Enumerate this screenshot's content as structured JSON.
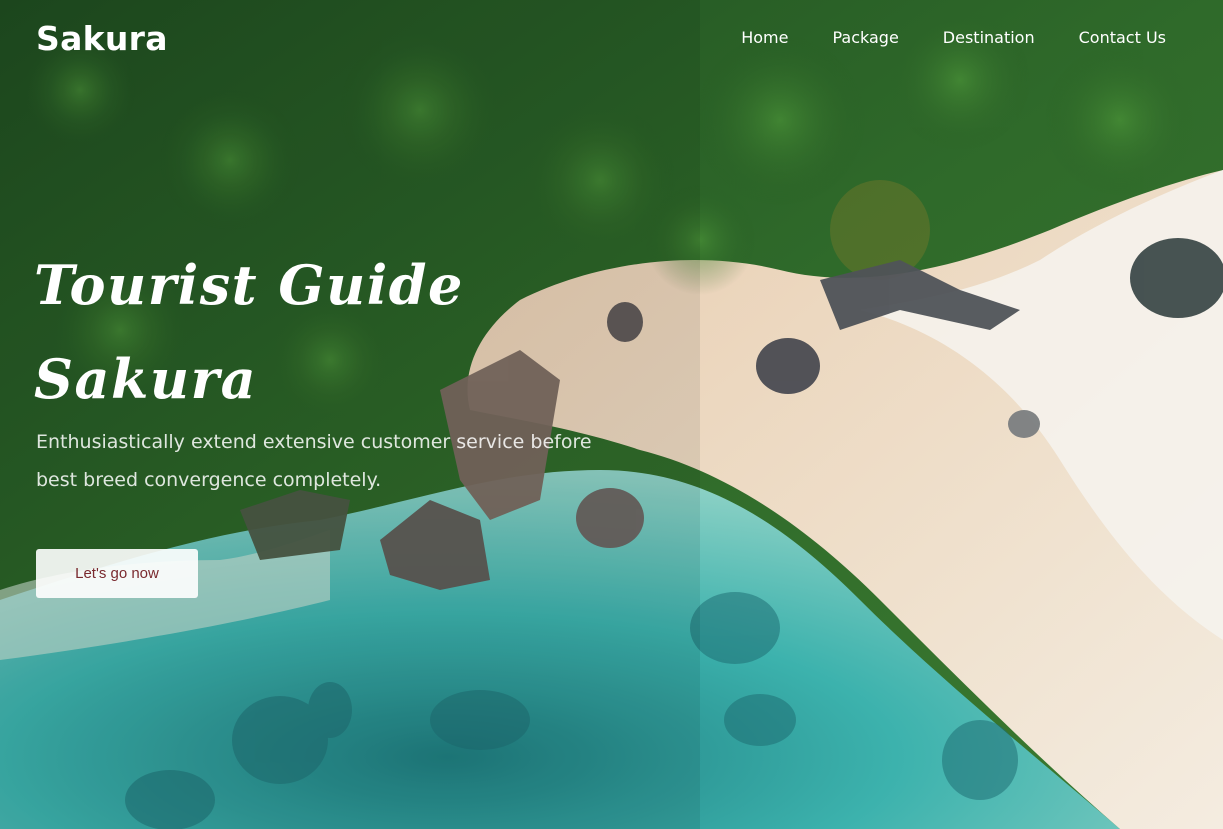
{
  "brand": {
    "name": "Sakura"
  },
  "nav": {
    "items": [
      {
        "label": "Home"
      },
      {
        "label": "Package"
      },
      {
        "label": "Destination"
      },
      {
        "label": "Contact Us"
      }
    ]
  },
  "hero": {
    "title_line1": "Tourist Guide",
    "title_line2": "Sakura",
    "description": "Enthusiastically extend extensive customer service before best breed convergence completely.",
    "cta_label": "Let's go now"
  },
  "colors": {
    "cta_text": "#7a2a2f",
    "foreground_text": "#ffffff",
    "forest": "#2a5a2a",
    "sand": "#e9d8c0",
    "water": "#3fb0aa"
  }
}
